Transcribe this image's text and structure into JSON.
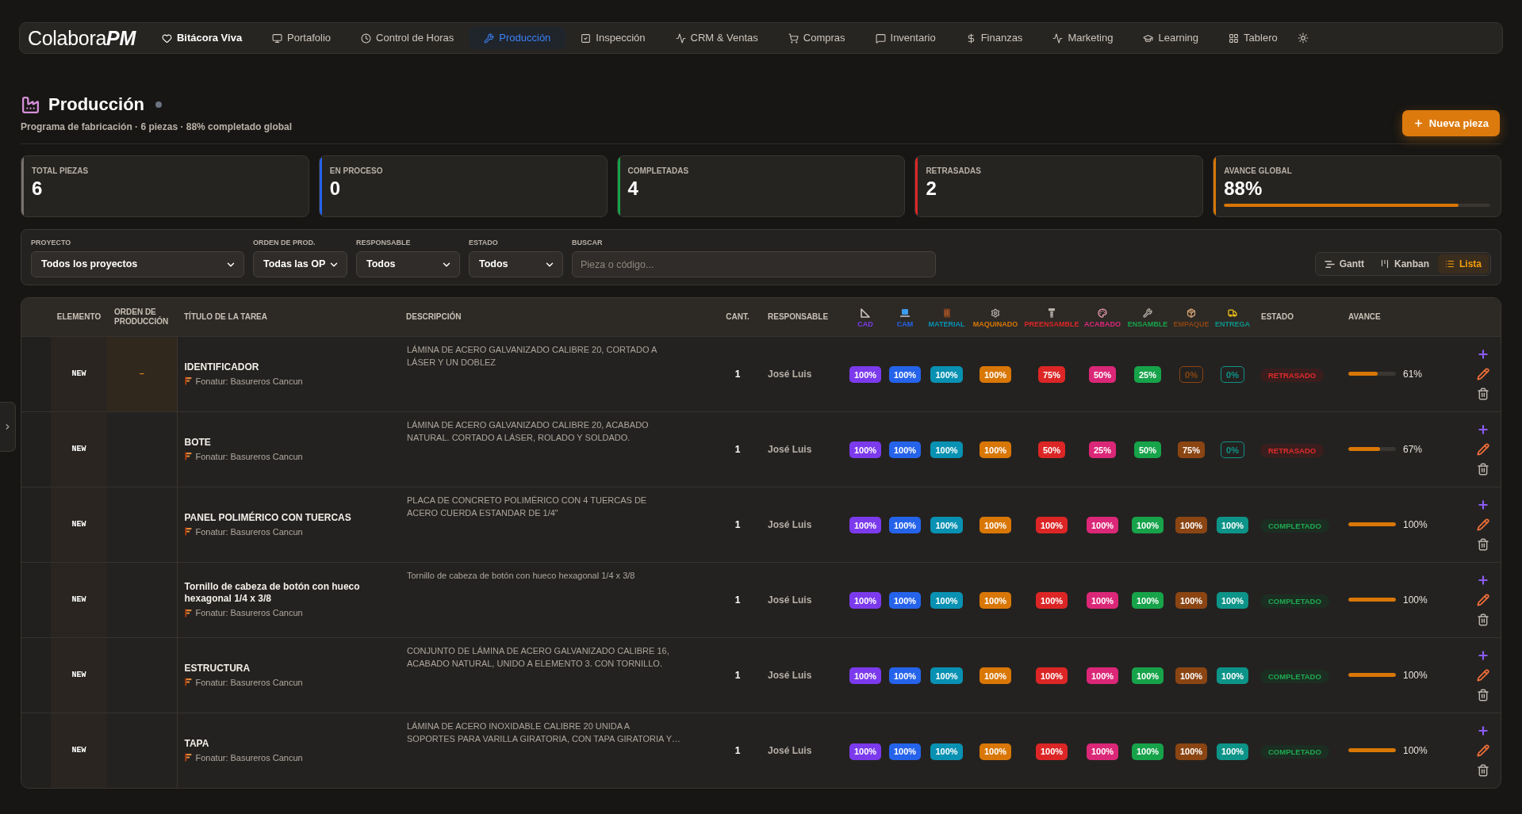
{
  "nav": {
    "logo": "Colabora**PM**",
    "items": [
      {
        "label": "Bitácora Viva",
        "selected": false,
        "emphasized": true
      },
      {
        "label": "Portafolio",
        "selected": false,
        "emphasized": false
      },
      {
        "label": "Control de Horas",
        "selected": false,
        "emphasized": false
      },
      {
        "label": "Producción",
        "selected": true,
        "emphasized": false
      },
      {
        "label": "Inspección",
        "selected": false,
        "emphasized": false
      },
      {
        "label": "CRM & Ventas",
        "selected": false,
        "emphasized": false
      },
      {
        "label": "Compras",
        "selected": false,
        "emphasized": false
      },
      {
        "label": "Inventario",
        "selected": false,
        "emphasized": false
      },
      {
        "label": "Finanzas",
        "selected": false,
        "emphasized": false
      },
      {
        "label": "Marketing",
        "selected": false,
        "emphasized": false
      },
      {
        "label": "Learning",
        "selected": false,
        "emphasized": false
      },
      {
        "label": "Tablero",
        "selected": false,
        "emphasized": false
      }
    ]
  },
  "header": {
    "title": "Producción",
    "subtitle": "Programa de fabricación · 6 piezas · 88% completado global",
    "new_button": "Nueva pieza"
  },
  "stats": [
    {
      "label": "TOTAL PIEZAS",
      "value": "6",
      "color": "#78716c"
    },
    {
      "label": "EN PROCESO",
      "value": "0",
      "color": "#2563eb"
    },
    {
      "label": "COMPLETADAS",
      "value": "4",
      "color": "#16a34a"
    },
    {
      "label": "RETRASADAS",
      "value": "2",
      "color": "#dc2626"
    },
    {
      "label": "AVANCE GLOBAL",
      "value": "88%",
      "color": "#d97706",
      "level": 0.88
    }
  ],
  "filters": [
    {
      "label": "PROYECTO",
      "kind": "select",
      "value": "Todos los proyectos"
    },
    {
      "label": "ORDEN DE PROD.",
      "kind": "select",
      "value": "Todas las OP"
    },
    {
      "label": "RESPONSABLE",
      "kind": "select",
      "value": "Todos"
    },
    {
      "label": "ESTADO",
      "kind": "select",
      "value": "Todos"
    },
    {
      "label": "BUSCAR",
      "kind": "search",
      "placeholder": "Pieza o código..."
    }
  ],
  "views": [
    {
      "label": "Gantt",
      "selected": false
    },
    {
      "label": "Kanban",
      "selected": false
    },
    {
      "label": "Lista",
      "selected": true
    }
  ],
  "table": {
    "columns": [
      "ELEMENTO",
      "ORDEN DE PRODUCCIÓN",
      "TÍTULO DE LA TAREA",
      "DESCRIPCIÓN",
      "CANT.",
      "RESPONSABLE"
    ],
    "stages": [
      {
        "label": "CAD",
        "color": "#7c3aed"
      },
      {
        "label": "CAM",
        "color": "#2563eb"
      },
      {
        "label": "MATERIAL",
        "color": "#0891b2"
      },
      {
        "label": "MAQUINADO",
        "color": "#d97706"
      },
      {
        "label": "PREENSAMBLE",
        "color": "#dc2626"
      },
      {
        "label": "ACABADO",
        "color": "#db2777"
      },
      {
        "label": "ENSAMBLE",
        "color": "#16a34a"
      },
      {
        "label": "EMPAQUE",
        "color": "#8b4513"
      },
      {
        "label": "ENTREGA",
        "color": "#0d9488"
      }
    ],
    "status_columns": [
      "ESTADO",
      "AVANCE"
    ],
    "rows": [
      {
        "element": "NEW",
        "order": "–",
        "title": "IDENTIFICADOR",
        "project": "Fonatur: Basureros Cancun",
        "description": "LÁMINA DE ACERO GALVANIZADO CALIBRE 20, CORTADO A\nLÁSER Y UN DOBLEZ",
        "qty": "1",
        "owner": "José Luis",
        "stages": [
          {
            "value": "100%",
            "started": true
          },
          {
            "value": "100%",
            "started": true
          },
          {
            "value": "100%",
            "started": true
          },
          {
            "value": "100%",
            "started": true
          },
          {
            "value": "75%",
            "started": true
          },
          {
            "value": "50%",
            "started": true
          },
          {
            "value": "25%",
            "started": true
          },
          {
            "value": "0%",
            "started": false
          },
          {
            "value": "0%",
            "started": false
          }
        ],
        "status": {
          "label": "RETRASADO",
          "kind": "late"
        },
        "progress": {
          "level": 0.61,
          "label": "61%"
        }
      },
      {
        "element": "NEW",
        "title": "BOTE",
        "project": "Fonatur: Basureros Cancun",
        "description": "LÁMINA DE ACERO GALVANIZADO CALIBRE 20, ACABADO\nNATURAL. CORTADO A LÁSER, ROLADO Y SOLDADO.",
        "qty": "1",
        "owner": "José Luis",
        "stages": [
          {
            "value": "100%",
            "started": true
          },
          {
            "value": "100%",
            "started": true
          },
          {
            "value": "100%",
            "started": true
          },
          {
            "value": "100%",
            "started": true
          },
          {
            "value": "50%",
            "started": true
          },
          {
            "value": "25%",
            "started": true
          },
          {
            "value": "50%",
            "started": true
          },
          {
            "value": "75%",
            "started": true
          },
          {
            "value": "0%",
            "started": false
          }
        ],
        "status": {
          "label": "RETRASADO",
          "kind": "late"
        },
        "progress": {
          "level": 0.67,
          "label": "67%"
        }
      },
      {
        "element": "NEW",
        "title": "PANEL POLIMÉRICO CON TUERCAS",
        "project": "Fonatur: Basureros Cancun",
        "description": "PLACA DE CONCRETO POLIMÉRICO CON 4 TUERCAS DE\nACERO CUERDA ESTANDAR DE 1/4\"",
        "qty": "1",
        "owner": "José Luis",
        "stages": [
          {
            "value": "100%",
            "started": true
          },
          {
            "value": "100%",
            "started": true
          },
          {
            "value": "100%",
            "started": true
          },
          {
            "value": "100%",
            "started": true
          },
          {
            "value": "100%",
            "started": true
          },
          {
            "value": "100%",
            "started": true
          },
          {
            "value": "100%",
            "started": true
          },
          {
            "value": "100%",
            "started": true
          },
          {
            "value": "100%",
            "started": true
          }
        ],
        "status": {
          "label": "COMPLETADO",
          "kind": "done"
        },
        "progress": {
          "level": 1,
          "label": "100%"
        }
      },
      {
        "element": "NEW",
        "title": "Tornillo de cabeza de botón con hueco hexagonal 1/4 x 3/8",
        "project": "Fonatur: Basureros Cancun",
        "description": "Tornillo de cabeza de botón con hueco hexagonal 1/4 x 3/8",
        "qty": "1",
        "owner": "José Luis",
        "stages": [
          {
            "value": "100%",
            "started": true
          },
          {
            "value": "100%",
            "started": true
          },
          {
            "value": "100%",
            "started": true
          },
          {
            "value": "100%",
            "started": true
          },
          {
            "value": "100%",
            "started": true
          },
          {
            "value": "100%",
            "started": true
          },
          {
            "value": "100%",
            "started": true
          },
          {
            "value": "100%",
            "started": true
          },
          {
            "value": "100%",
            "started": true
          }
        ],
        "status": {
          "label": "COMPLETADO",
          "kind": "done"
        },
        "progress": {
          "level": 1,
          "label": "100%"
        }
      },
      {
        "element": "NEW",
        "title": "ESTRUCTURA",
        "project": "Fonatur: Basureros Cancun",
        "description": "CONJUNTO DE LÁMINA DE ACERO GALVANIZADO CALIBRE 16,\nACABADO NATURAL, UNIDO A ELEMENTO 3. CON TORNILLO.",
        "qty": "1",
        "owner": "José Luis",
        "stages": [
          {
            "value": "100%",
            "started": true
          },
          {
            "value": "100%",
            "started": true
          },
          {
            "value": "100%",
            "started": true
          },
          {
            "value": "100%",
            "started": true
          },
          {
            "value": "100%",
            "started": true
          },
          {
            "value": "100%",
            "started": true
          },
          {
            "value": "100%",
            "started": true
          },
          {
            "value": "100%",
            "started": true
          },
          {
            "value": "100%",
            "started": true
          }
        ],
        "status": {
          "label": "COMPLETADO",
          "kind": "done"
        },
        "progress": {
          "level": 1,
          "label": "100%"
        }
      },
      {
        "element": "NEW",
        "title": "TAPA",
        "project": "Fonatur: Basureros Cancun",
        "description": "LÁMINA DE ACERO INOXIDABLE CALIBRE 20 UNIDA A\nSOPORTES PARA VARILLA GIRATORIA, CON TAPA GIRATORIA Y…",
        "qty": "1",
        "owner": "José Luis",
        "stages": [
          {
            "value": "100%",
            "started": true
          },
          {
            "value": "100%",
            "started": true
          },
          {
            "value": "100%",
            "started": true
          },
          {
            "value": "100%",
            "started": true
          },
          {
            "value": "100%",
            "started": true
          },
          {
            "value": "100%",
            "started": true
          },
          {
            "value": "100%",
            "started": true
          },
          {
            "value": "100%",
            "started": true
          },
          {
            "value": "100%",
            "started": true
          }
        ],
        "status": {
          "label": "COMPLETADO",
          "kind": "done"
        },
        "progress": {
          "level": 1,
          "label": "100%"
        }
      }
    ]
  }
}
